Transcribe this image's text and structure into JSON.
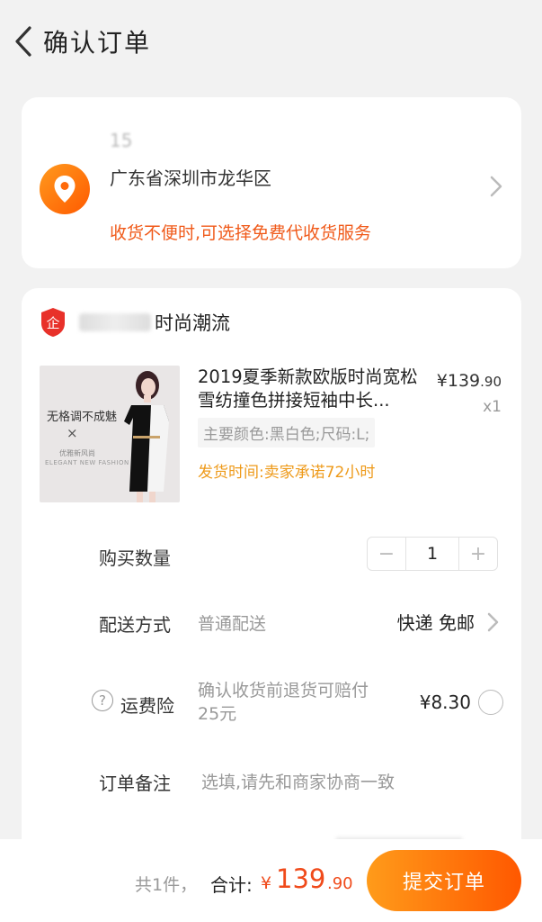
{
  "header": {
    "title": "确认订单"
  },
  "address": {
    "name_phone": "15",
    "line1": "广东省深圳市龙华区",
    "line2": "",
    "tip": "收货不便时,可选择免费代收货服务"
  },
  "shop": {
    "name": "时尚潮流"
  },
  "product": {
    "title": "2019夏季新款欧版时尚宽松雪纺撞色拼接短袖中长...",
    "price_symbol": "¥",
    "price_int": "139",
    "price_dec": ".90",
    "qty": "x1",
    "sku": "主要颜色:黑白色;尺码:L;",
    "ship_time": "发货时间:卖家承诺72小时",
    "image_text1": "无格调不成魅",
    "image_x": "×",
    "image_text2": "优雅新风尚",
    "image_text3": "ELEGANT NEW FASHION"
  },
  "quantity": {
    "label": "购买数量",
    "minus": "−",
    "value": "1",
    "plus": "+"
  },
  "delivery": {
    "label": "配送方式",
    "value": "普通配送",
    "right": "快递 免邮"
  },
  "insurance": {
    "label": "运费险",
    "help": "?",
    "desc": "确认收货前退货可赔付25元",
    "price": "¥8.30"
  },
  "remark": {
    "label": "订单备注",
    "placeholder": "选填,请先和商家协商一致"
  },
  "bottom": {
    "count": "共1件，",
    "total_label": "合计:",
    "total_symbol": "¥",
    "total_int": "139",
    "total_dec": ".90",
    "submit": "提交订单"
  },
  "colors": {
    "accent": "#ff5a00",
    "accent_light": "#ff9b1a",
    "price_red": "#f04a1a",
    "ship_orange": "#ee9a1a"
  }
}
